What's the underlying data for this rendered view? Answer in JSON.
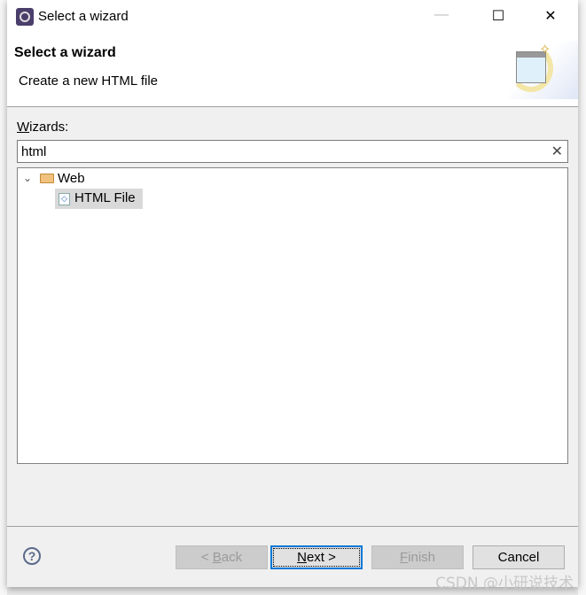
{
  "window": {
    "title": "Select a wizard",
    "minimize": "—",
    "maximize": "☐",
    "close": "✕"
  },
  "header": {
    "title": "Select a wizard",
    "description": "Create a new HTML file"
  },
  "wizards": {
    "label_accel": "W",
    "label_rest": "izards:",
    "filter_value": "html",
    "clear_icon": "✕"
  },
  "tree": {
    "expand": "⌄",
    "category": "Web",
    "item": "HTML File"
  },
  "buttons": {
    "back": {
      "pre": "< ",
      "accel": "B",
      "rest": "ack"
    },
    "next": {
      "accel": "N",
      "rest": "ext >"
    },
    "finish": {
      "accel": "F",
      "rest": "inish"
    },
    "cancel": "Cancel",
    "help": "?"
  },
  "watermark": "CSDN @小研说技术"
}
